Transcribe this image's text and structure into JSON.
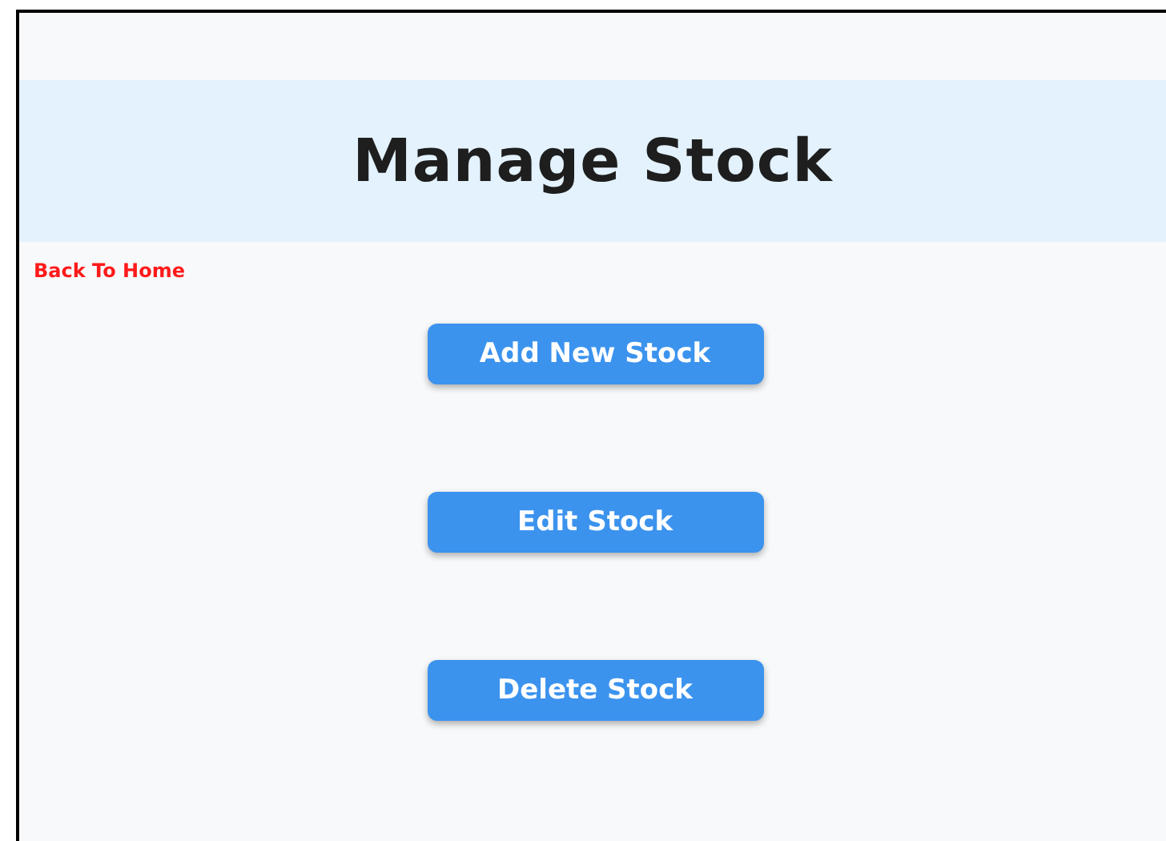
{
  "header": {
    "title": "Manage Stock"
  },
  "back_link": "Back To Home",
  "buttons": [
    "Add New Stock",
    "Edit Stock",
    "Delete Stock"
  ]
}
